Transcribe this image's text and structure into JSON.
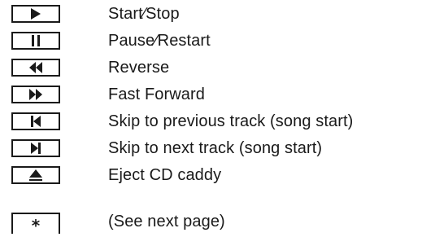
{
  "legend": {
    "rows": [
      {
        "icon": "play-icon",
        "description": "Start∕Stop"
      },
      {
        "icon": "pause-icon",
        "description": "Pause∕Restart"
      },
      {
        "icon": "rewind-icon",
        "description": "Reverse"
      },
      {
        "icon": "fast-forward-icon",
        "description": "Fast Forward"
      },
      {
        "icon": "skip-previous-icon",
        "description": "Skip to previous track (song start)"
      },
      {
        "icon": "skip-next-icon",
        "description": "Skip to next track (song start)"
      },
      {
        "icon": "eject-icon",
        "description": "Eject CD caddy"
      },
      {
        "icon": "asterisk-icon",
        "glyph": "*",
        "description": "(See next page)"
      }
    ]
  }
}
